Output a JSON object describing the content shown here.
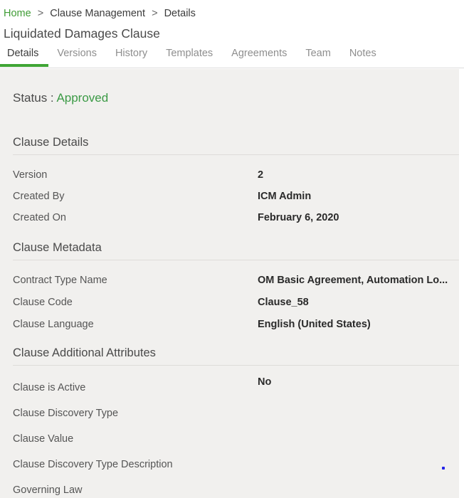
{
  "header": {
    "breadcrumb": [
      {
        "label": "Home",
        "type": "link"
      },
      {
        "label": "Clause Management",
        "type": "plain"
      },
      {
        "label": "Details",
        "type": "plain"
      }
    ],
    "separator": ">",
    "title": "Liquidated Damages Clause",
    "tabs": [
      {
        "label": "Details",
        "active": true
      },
      {
        "label": "Versions",
        "active": false
      },
      {
        "label": "History",
        "active": false
      },
      {
        "label": "Templates",
        "active": false
      },
      {
        "label": "Agreements",
        "active": false
      },
      {
        "label": "Team",
        "active": false
      },
      {
        "label": "Notes",
        "active": false
      }
    ]
  },
  "status": {
    "label": "Status :",
    "value": "Approved"
  },
  "sections": [
    {
      "title": "Clause Details",
      "fields": [
        {
          "label": "Version",
          "value": "2"
        },
        {
          "label": "Created By",
          "value": "ICM Admin"
        },
        {
          "label": "Created On",
          "value": "February 6, 2020"
        }
      ]
    },
    {
      "title": "Clause Metadata",
      "fields": [
        {
          "label": "Contract Type Name",
          "value": "OM Basic Agreement, Automation Lo..."
        },
        {
          "label": "Clause Code",
          "value": "Clause_58"
        },
        {
          "label": "Clause Language",
          "value": "English (United States)"
        }
      ]
    },
    {
      "title": "Clause Additional Attributes",
      "fields": [
        {
          "label": "Clause is Active",
          "value": "No"
        },
        {
          "label": "Clause Discovery Type",
          "value": ""
        },
        {
          "label": "Clause Value",
          "value": ""
        },
        {
          "label": "Clause Discovery Type Description",
          "value": ""
        },
        {
          "label": "Governing Law",
          "value": ""
        }
      ]
    }
  ],
  "colors": {
    "accent_green": "#3fa535",
    "status_green": "#3b9a45",
    "link_green": "#3f9c35",
    "content_bg": "#f1f0ee",
    "divider": "#dedcd9",
    "cursor_dot": "#2323e8"
  }
}
